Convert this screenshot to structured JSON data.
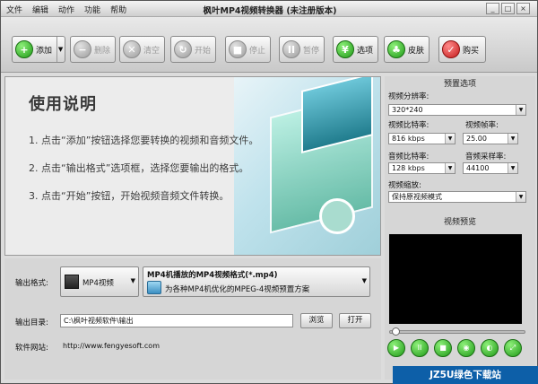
{
  "window": {
    "title": "枫叶MP4视频转换器 (未注册版本)",
    "min": "_",
    "max": "□",
    "close": "×"
  },
  "menu": [
    "文件",
    "编辑",
    "动作",
    "功能",
    "帮助"
  ],
  "toolbar": {
    "add": "添加",
    "delete": "删除",
    "clear": "清空",
    "start": "开始",
    "stop": "停止",
    "pause": "暂停",
    "options": "选项",
    "skin": "皮肤",
    "buy": "购买"
  },
  "instructions": {
    "title": "使用说明",
    "steps": [
      "1. 点击“添加”按钮选择您要转换的视频和音频文件。",
      "2. 点击“输出格式”选项框，选择您要输出的格式。",
      "3. 点击“开始”按钮，开始视频音频文件转换。"
    ]
  },
  "output": {
    "format_label": "输出格式:",
    "format_category": "MP4视频",
    "format_name": "MP4机播放的MP4视频格式(*.mp4)",
    "format_desc": "为各种MP4机优化的MPEG-4视频预置方案",
    "dir_label": "输出目录:",
    "dir_value": "C:\\枫叶视频软件\\输出",
    "browse": "浏览",
    "open": "打开",
    "site_label": "软件网站:",
    "site_url": "http://www.fengyesoft.com"
  },
  "preset": {
    "header": "预置选项",
    "resolution_label": "视频分辨率:",
    "resolution": "320*240",
    "vbitrate_label": "视频比特率:",
    "vbitrate": "816 kbps",
    "framerate_label": "视频帧率:",
    "framerate": "25.00",
    "abitrate_label": "音频比特率:",
    "abitrate": "128 kbps",
    "samplerate_label": "音频采样率:",
    "samplerate": "44100",
    "zoom_label": "视频缩放:",
    "zoom": "保持原视频模式"
  },
  "preview": {
    "header": "视频预览"
  },
  "watermark": "JZ5U绿色下载站www.jz5u.com"
}
